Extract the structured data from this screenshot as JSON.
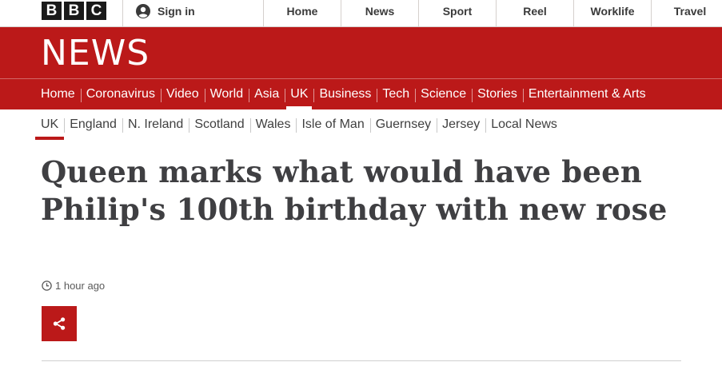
{
  "brand": {
    "letters": [
      "B",
      "B",
      "C"
    ]
  },
  "account": {
    "signin_label": "Sign in"
  },
  "top_nav": [
    {
      "label": "Home"
    },
    {
      "label": "News"
    },
    {
      "label": "Sport"
    },
    {
      "label": "Reel"
    },
    {
      "label": "Worklife"
    },
    {
      "label": "Travel"
    }
  ],
  "banner": {
    "title": "NEWS",
    "background": "#bb1919"
  },
  "main_nav": [
    {
      "label": "Home"
    },
    {
      "label": "Coronavirus"
    },
    {
      "label": "Video"
    },
    {
      "label": "World"
    },
    {
      "label": "Asia"
    },
    {
      "label": "UK",
      "active": true
    },
    {
      "label": "Business"
    },
    {
      "label": "Tech"
    },
    {
      "label": "Science"
    },
    {
      "label": "Stories"
    },
    {
      "label": "Entertainment & Arts"
    }
  ],
  "sub_nav": [
    {
      "label": "UK",
      "active": true
    },
    {
      "label": "England"
    },
    {
      "label": "N. Ireland"
    },
    {
      "label": "Scotland"
    },
    {
      "label": "Wales"
    },
    {
      "label": "Isle of Man"
    },
    {
      "label": "Guernsey"
    },
    {
      "label": "Jersey"
    },
    {
      "label": "Local News"
    }
  ],
  "article": {
    "headline": "Queen marks what would have been Philip's 100th birthday with new rose",
    "timestamp": "1 hour ago",
    "share_icon": "share-icon",
    "clock_icon": "clock-icon"
  },
  "colors": {
    "accent": "#bb1919",
    "headline": "#3f3f42"
  }
}
